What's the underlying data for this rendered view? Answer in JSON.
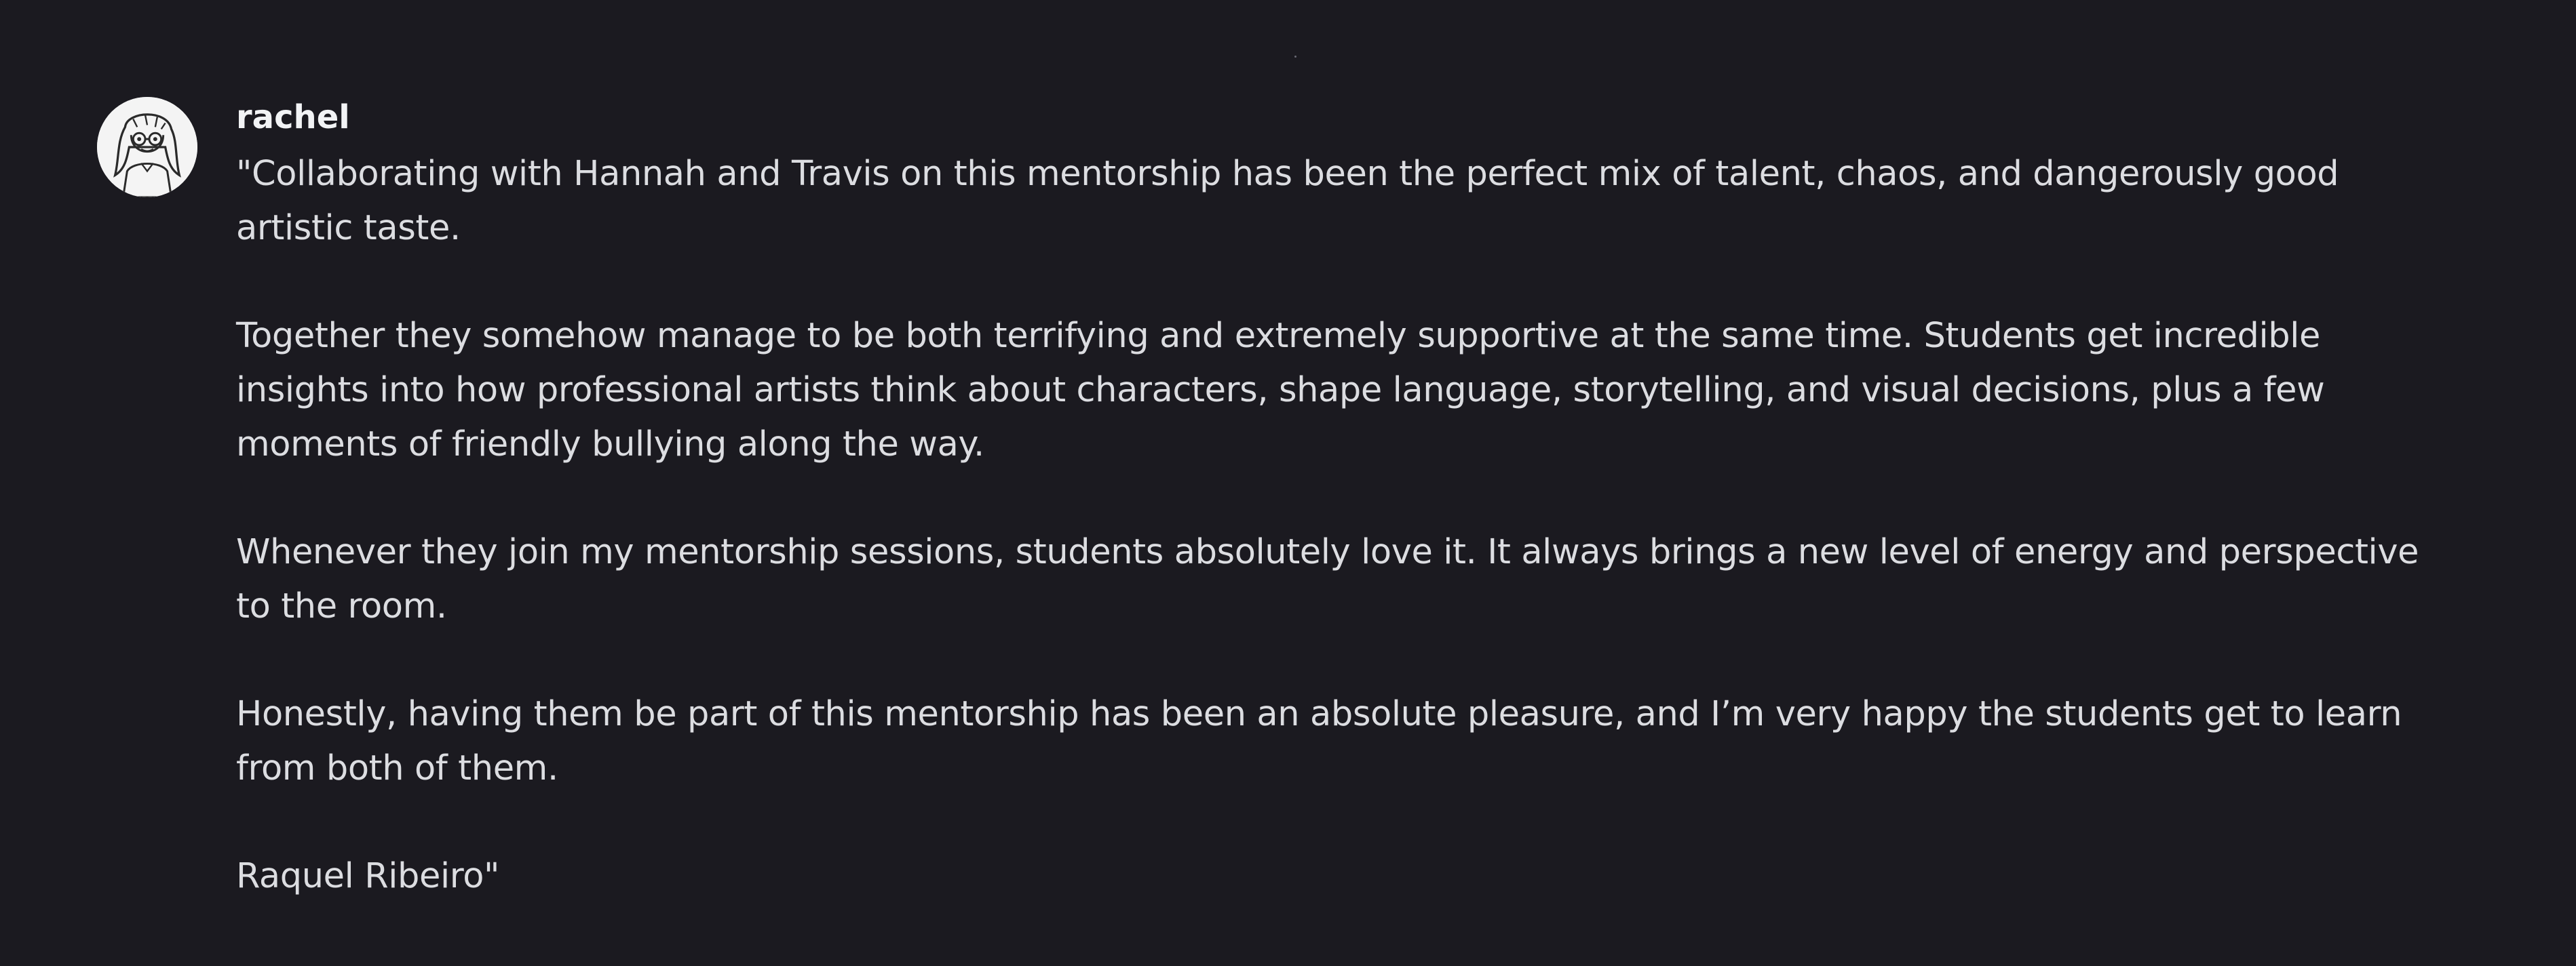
{
  "message": {
    "author": "rachel",
    "avatar_icon": "sketched-girl-avatar",
    "paragraphs": [
      "\"Collaborating with Hannah and Travis on this mentorship has been the perfect mix of talent, chaos, and dangerously good artistic taste.",
      "Together they somehow manage to be both terrifying and extremely supportive at the same time. Students get incredible insights into how professional artists think about characters, shape language, storytelling, and visual decisions, plus a few moments of friendly bullying along the way.",
      "Whenever they join my mentorship sessions, students absolutely love it. It always brings a new level of energy and perspective to the room.",
      "Honestly, having them be part of this mentorship has been an absolute pleasure, and I’m very happy the students get to learn from both of them.",
      "Raquel Ribeiro\""
    ]
  },
  "colors": {
    "background": "#1b1a20",
    "username": "#f2f3f5",
    "text": "#dcdde1"
  }
}
